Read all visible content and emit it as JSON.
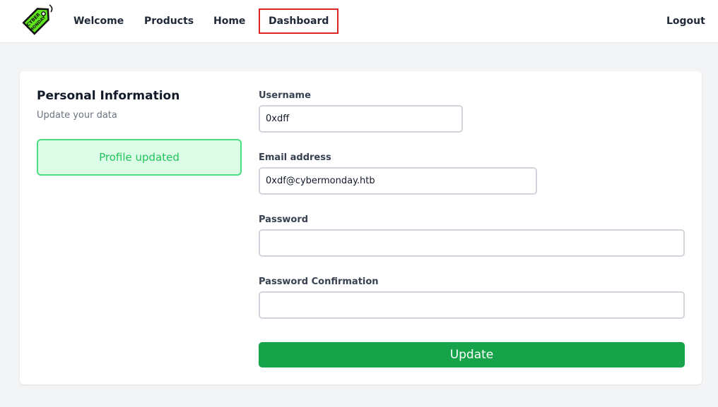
{
  "nav": {
    "logo_text_top": "CYBER",
    "logo_text_bottom": "MONDAY",
    "links": [
      "Welcome",
      "Products",
      "Home",
      "Dashboard"
    ],
    "active": "Dashboard",
    "logout": "Logout"
  },
  "profile": {
    "title": "Personal Information",
    "subtitle": "Update your data",
    "alert": "Profile updated"
  },
  "form": {
    "username_label": "Username",
    "username_value": "0xdff",
    "email_label": "Email address",
    "email_value": "0xdf@cybermonday.htb",
    "password_label": "Password",
    "password_value": "",
    "password_confirm_label": "Password Confirmation",
    "password_confirm_value": "",
    "submit_label": "Update"
  },
  "colors": {
    "accent": "#16a34a",
    "alert_bg": "#dcfce7",
    "alert_border": "#4ade80",
    "active_border": "#dc2626",
    "logo_green": "#4ade16"
  }
}
